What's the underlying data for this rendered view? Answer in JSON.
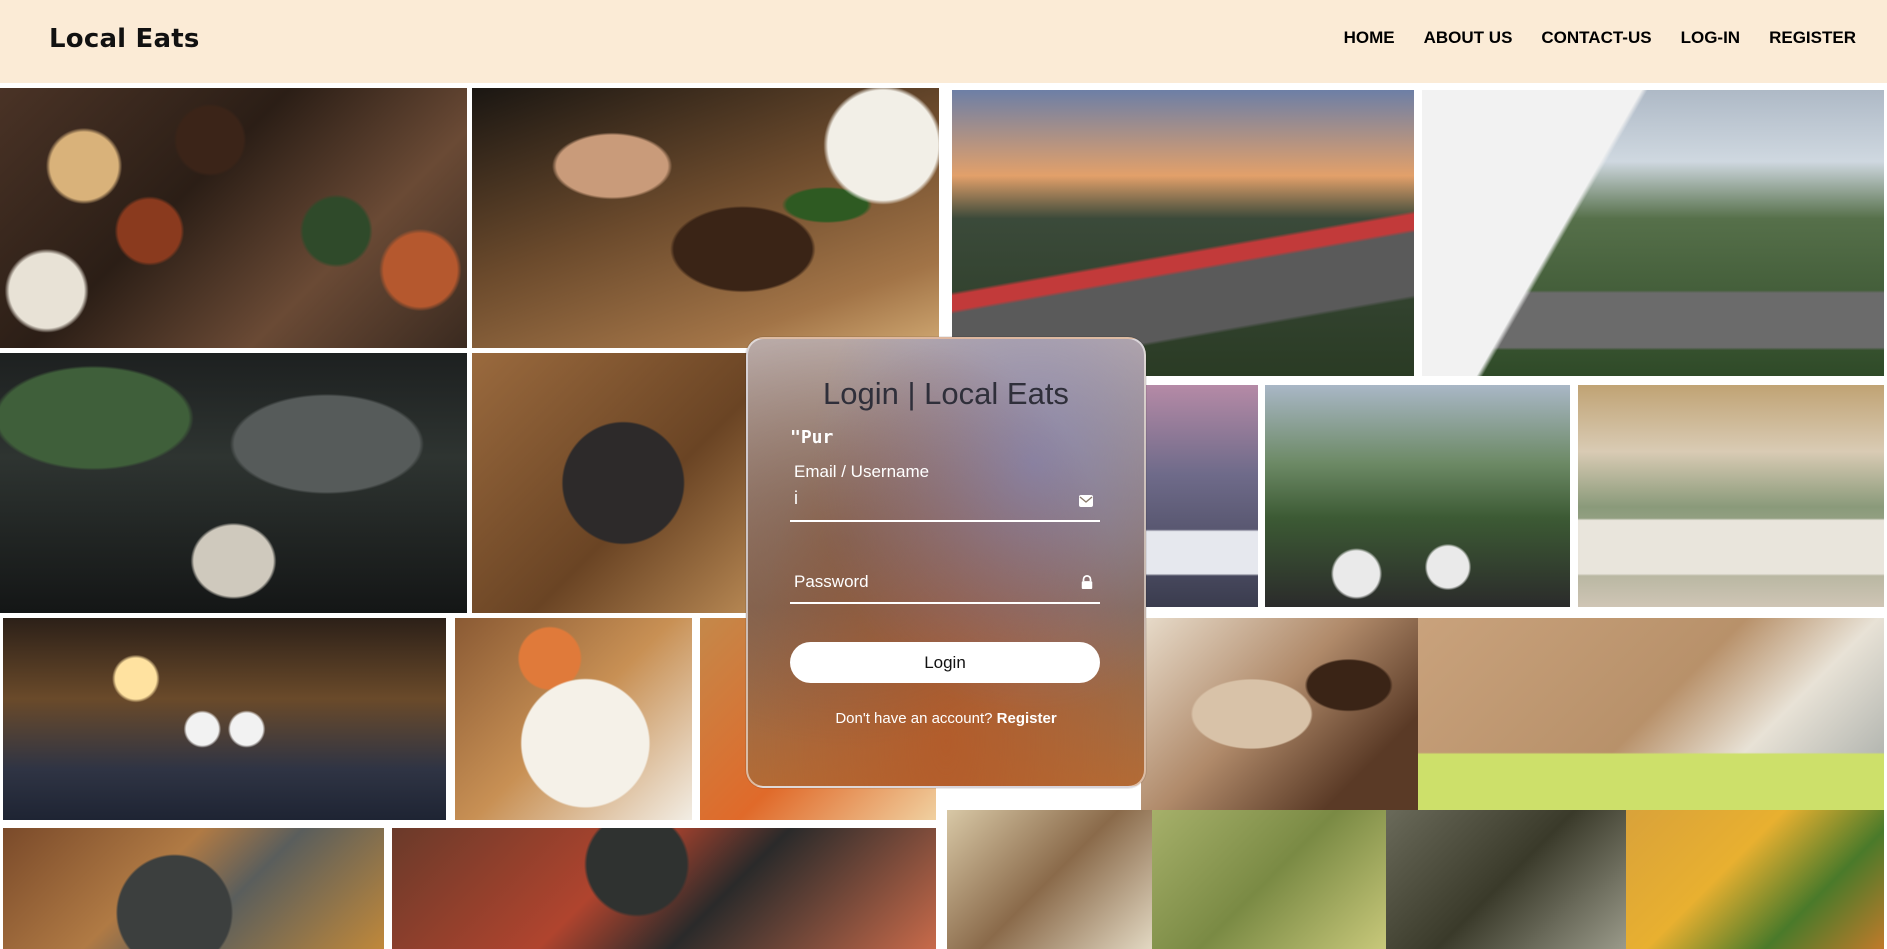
{
  "header": {
    "logo": "Local Eats",
    "nav": [
      "HOME",
      "ABOUT US",
      "CONTACT-US",
      "LOG-IN",
      "REGISTER"
    ]
  },
  "login": {
    "title": "Login | Local Eats",
    "stray_text": "\"Pur",
    "email_label": "Email / Username",
    "email_value": "i",
    "email_icon": "envelope-icon",
    "password_placeholder": "Password",
    "password_icon": "lock-icon",
    "button_label": "Login",
    "register_prompt": "Don't have an account?",
    "register_link": "Register"
  },
  "colors": {
    "header_bg": "#fbebd6",
    "card_accent": "#b36b35"
  },
  "gallery": [
    "food-platter-photo",
    "pork-chop-photo",
    "mountain-restaurant-sunset-photo",
    "terrace-view-photo",
    "bar-interior-photo",
    "steak-plate-photo",
    "rooftop-dining-photo",
    "balcony-dining-photo",
    "lounge-terrace-photo",
    "street-restaurant-photo",
    "scallops-photo",
    "shrimp-photo",
    "lechon-photo",
    "ricos-lechon-box-photo",
    "korean-bbq-photo",
    "korean-banchan-photo",
    "dumplings-photo",
    "puso-rice-photo",
    "grilled-oysters-photo",
    "vegetable-stew-photo"
  ]
}
